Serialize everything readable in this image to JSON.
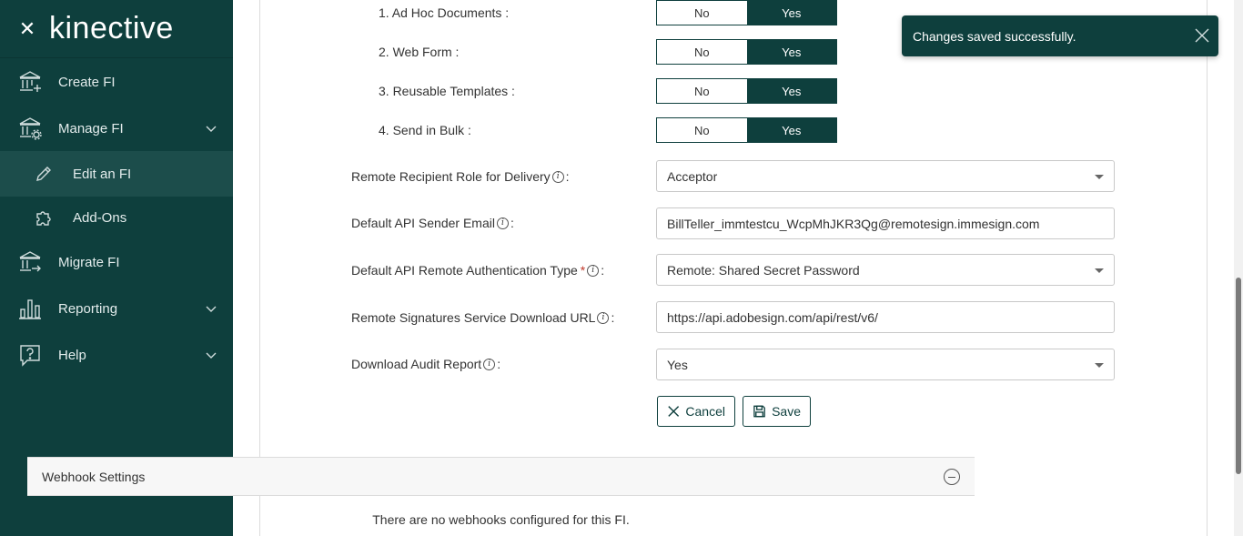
{
  "sidebar": {
    "logo": "kinective",
    "items": [
      {
        "label": "Create FI",
        "icon": "bank-plus-icon"
      },
      {
        "label": "Manage FI",
        "icon": "bank-gear-icon"
      },
      {
        "label": "Edit an FI",
        "icon": "pencil-icon"
      },
      {
        "label": "Add-Ons",
        "icon": "puzzle-icon"
      },
      {
        "label": "Migrate FI",
        "icon": "bank-arrow-icon"
      },
      {
        "label": "Reporting",
        "icon": "bar-chart-icon"
      },
      {
        "label": "Help",
        "icon": "question-bubble-icon"
      }
    ]
  },
  "toggles": [
    {
      "label": "1. Ad Hoc Documents :",
      "no": "No",
      "yes": "Yes",
      "selected": "Yes"
    },
    {
      "label": "2. Web Form :",
      "no": "No",
      "yes": "Yes",
      "selected": "Yes"
    },
    {
      "label": "3. Reusable Templates :",
      "no": "No",
      "yes": "Yes",
      "selected": "Yes"
    },
    {
      "label": "4. Send in Bulk :",
      "no": "No",
      "yes": "Yes",
      "selected": "Yes"
    }
  ],
  "fields": {
    "role": {
      "label": "Remote Recipient Role for Delivery",
      "value": "Acceptor"
    },
    "email": {
      "label": "Default API Sender Email",
      "value": "BillTeller_immtestcu_WcpMhJKR3Qg@remotesign.immesign.com"
    },
    "auth": {
      "label": "Default API Remote Authentication Type",
      "required": "*",
      "value": "Remote: Shared Secret Password"
    },
    "url": {
      "label": "Remote Signatures Service Download URL",
      "value": "https://api.adobesign.com/api/rest/v6/"
    },
    "audit": {
      "label": "Download Audit Report",
      "value": "Yes"
    }
  },
  "colon": ":",
  "info_glyph": "i",
  "buttons": {
    "cancel": "Cancel",
    "save": "Save"
  },
  "webhooks": {
    "title": "Webhook Settings",
    "empty": "There are no webhooks configured for this FI."
  },
  "toast": {
    "message": "Changes saved successfully."
  },
  "colors": {
    "primary": "#0e3f3d",
    "required": "#c0392b"
  }
}
